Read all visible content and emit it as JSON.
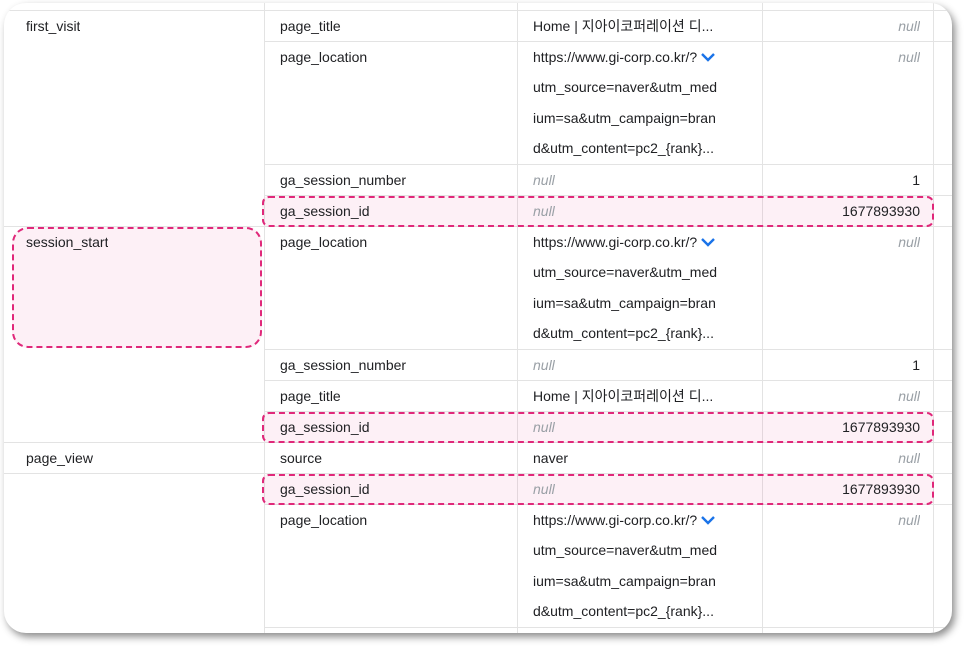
{
  "events": {
    "first_visit": "first_visit",
    "session_start": "session_start",
    "page_view": "page_view"
  },
  "rows": [
    {
      "key": "page_title",
      "string_value": "Home | 지아이코퍼레이션 디...",
      "int_value": "null"
    },
    {
      "key": "page_location",
      "url_lines": [
        "https://www.gi-corp.co.kr/?",
        "utm_source=naver&utm_med",
        "ium=sa&utm_campaign=bran",
        "d&utm_content=pc2_{rank}..."
      ],
      "int_value": "null"
    },
    {
      "key": "ga_session_number",
      "string_value": "null",
      "int_value": "1"
    },
    {
      "key": "ga_session_id",
      "string_value": "null",
      "int_value": "1677893930"
    },
    {
      "key": "page_location",
      "url_lines": [
        "https://www.gi-corp.co.kr/?",
        "utm_source=naver&utm_med",
        "ium=sa&utm_campaign=bran",
        "d&utm_content=pc2_{rank}..."
      ],
      "int_value": "null"
    },
    {
      "key": "ga_session_number",
      "string_value": "null",
      "int_value": "1"
    },
    {
      "key": "page_title",
      "string_value": "Home | 지아이코퍼레이션 디...",
      "int_value": "null"
    },
    {
      "key": "ga_session_id",
      "string_value": "null",
      "int_value": "1677893930"
    },
    {
      "key": "source",
      "string_value": "naver",
      "int_value": "null"
    },
    {
      "key": "ga_session_id",
      "string_value": "null",
      "int_value": "1677893930"
    },
    {
      "key": "page_location",
      "url_lines": [
        "https://www.gi-corp.co.kr/?",
        "utm_source=naver&utm_med",
        "ium=sa&utm_campaign=bran",
        "d&utm_content=pc2_{rank}..."
      ],
      "int_value": "null"
    }
  ],
  "colors": {
    "highlight": "#e0287a",
    "chevron": "#1a73e8",
    "null_text": "#9aa0a6"
  },
  "icons": {
    "expand": "chevron-down-icon"
  }
}
